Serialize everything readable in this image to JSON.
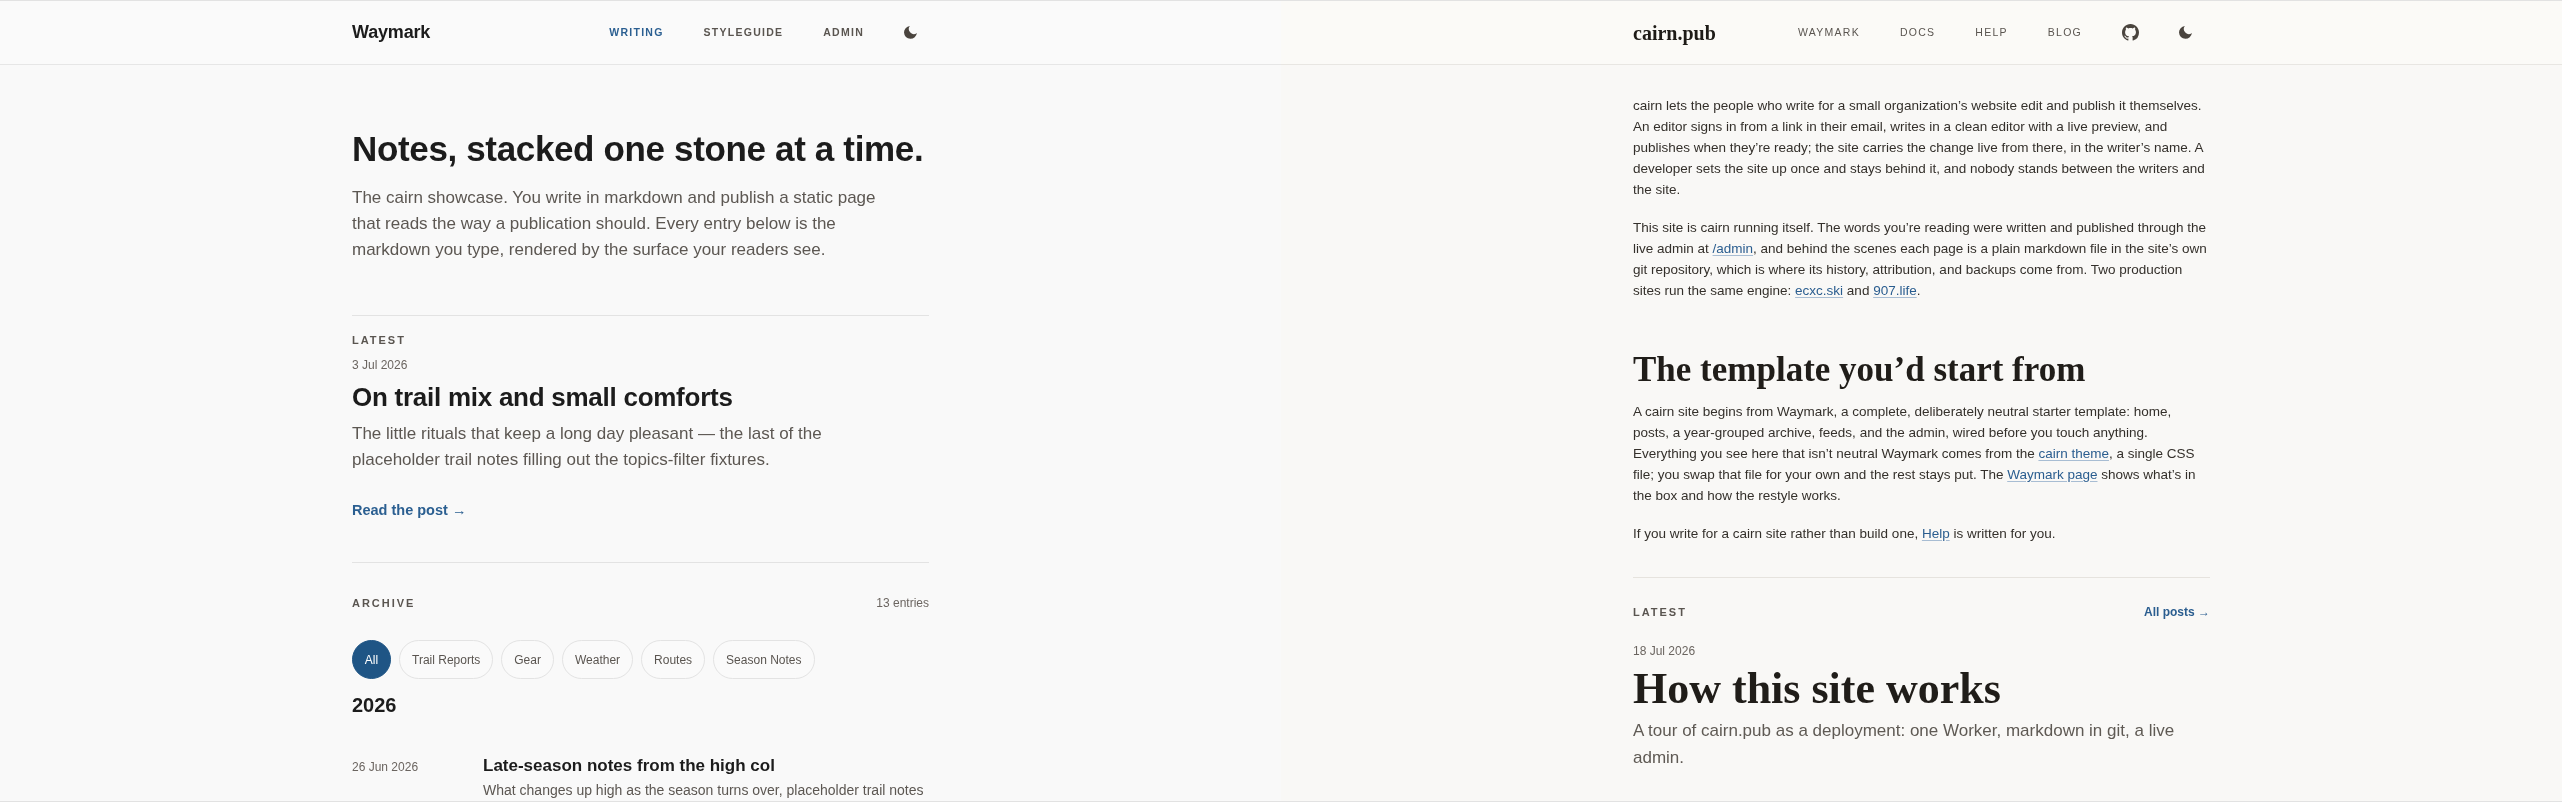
{
  "left_site": {
    "header": {
      "logo": "Waymark",
      "nav": [
        {
          "label": "WRITING",
          "selected": true
        },
        {
          "label": "STYLEGUIDE",
          "selected": false
        },
        {
          "label": "ADMIN",
          "selected": false
        }
      ]
    },
    "hero": {
      "title": "Notes, stacked one stone at a time.",
      "subtitle": "The cairn showcase. You write in markdown and publish a static page that reads the way a publication should. Every entry below is the markdown you type, rendered by the surface your readers see."
    },
    "latest": {
      "label": "LATEST",
      "date": "3 Jul 2026",
      "title": "On trail mix and small comforts",
      "summary": "The little rituals that keep a long day pleasant — the last of the placeholder trail notes filling out the topics-filter fixtures.",
      "link": "Read the post →"
    },
    "archive": {
      "label": "ARCHIVE",
      "count": "13 entries",
      "filters": [
        {
          "label": "All",
          "selected": true
        },
        {
          "label": "Trail Reports",
          "selected": false
        },
        {
          "label": "Gear",
          "selected": false
        },
        {
          "label": "Weather",
          "selected": false
        },
        {
          "label": "Routes",
          "selected": false
        },
        {
          "label": "Season Notes",
          "selected": false
        }
      ],
      "years": [
        {
          "year": "2026",
          "entries": [
            {
              "date": "26 Jun 2026",
              "title": "Late-season notes from the high col",
              "summary": "What changes up high as the season turns over, placeholder trail notes"
            }
          ]
        }
      ]
    }
  },
  "right_site": {
    "header": {
      "logo": "cairn.pub",
      "nav": [
        {
          "label": "WAYMARK",
          "selected": false
        },
        {
          "label": "DOCS",
          "selected": false
        },
        {
          "label": "HELP",
          "selected": false
        },
        {
          "label": "BLOG",
          "selected": false
        }
      ]
    },
    "intro": [
      {
        "segments": [
          {
            "kind": "text",
            "text": "cairn lets the people who write for a small organization’s website edit and publish it themselves. An editor signs in from a link in their email, writes in a clean editor with a live preview, and publishes when they’re ready; the site carries the change live from there, in the writer’s name. A developer sets the site up once and stays behind it, and nobody stands between the writers and the site."
          }
        ]
      },
      {
        "segments": [
          {
            "kind": "text",
            "text": "This site is cairn running itself. The words you’re reading were written and published through the live admin at "
          },
          {
            "kind": "link",
            "text": "/admin"
          },
          {
            "kind": "text",
            "text": ", and behind the scenes each page is a plain markdown file in the site’s own git repository, which is where its history, attribution, and backups come from. Two production sites run the same engine: "
          },
          {
            "kind": "link",
            "text": "ecxc.ski"
          },
          {
            "kind": "text",
            "text": " and "
          },
          {
            "kind": "link",
            "text": "907.life"
          },
          {
            "kind": "text",
            "text": "."
          }
        ]
      }
    ],
    "section": {
      "heading": "The template you’d start from",
      "paragraphs": [
        {
          "segments": [
            {
              "kind": "text",
              "text": "A cairn site begins from Waymark, a complete, deliberately neutral starter template: home, posts, a year-grouped archive, feeds, and the admin, wired before you touch anything. Everything you see here that isn’t neutral Waymark comes from the "
            },
            {
              "kind": "link",
              "text": "cairn theme"
            },
            {
              "kind": "text",
              "text": ", a single CSS file; you swap that file for your own and the rest stays put. The "
            },
            {
              "kind": "link",
              "text": "Waymark page"
            },
            {
              "kind": "text",
              "text": " shows what’s in the box and how the restyle works."
            }
          ]
        },
        {
          "segments": [
            {
              "kind": "text",
              "text": "If you write for a cairn site rather than build one, "
            },
            {
              "kind": "link",
              "text": "Help"
            },
            {
              "kind": "text",
              "text": " is written for you."
            }
          ]
        }
      ]
    },
    "latest": {
      "label": "LATEST",
      "link": "All posts →",
      "date": "18 Jul 2026",
      "title": "How this site works",
      "summary": "A tour of cairn.pub as a deployment: one Worker, markdown in git, a live admin."
    }
  }
}
